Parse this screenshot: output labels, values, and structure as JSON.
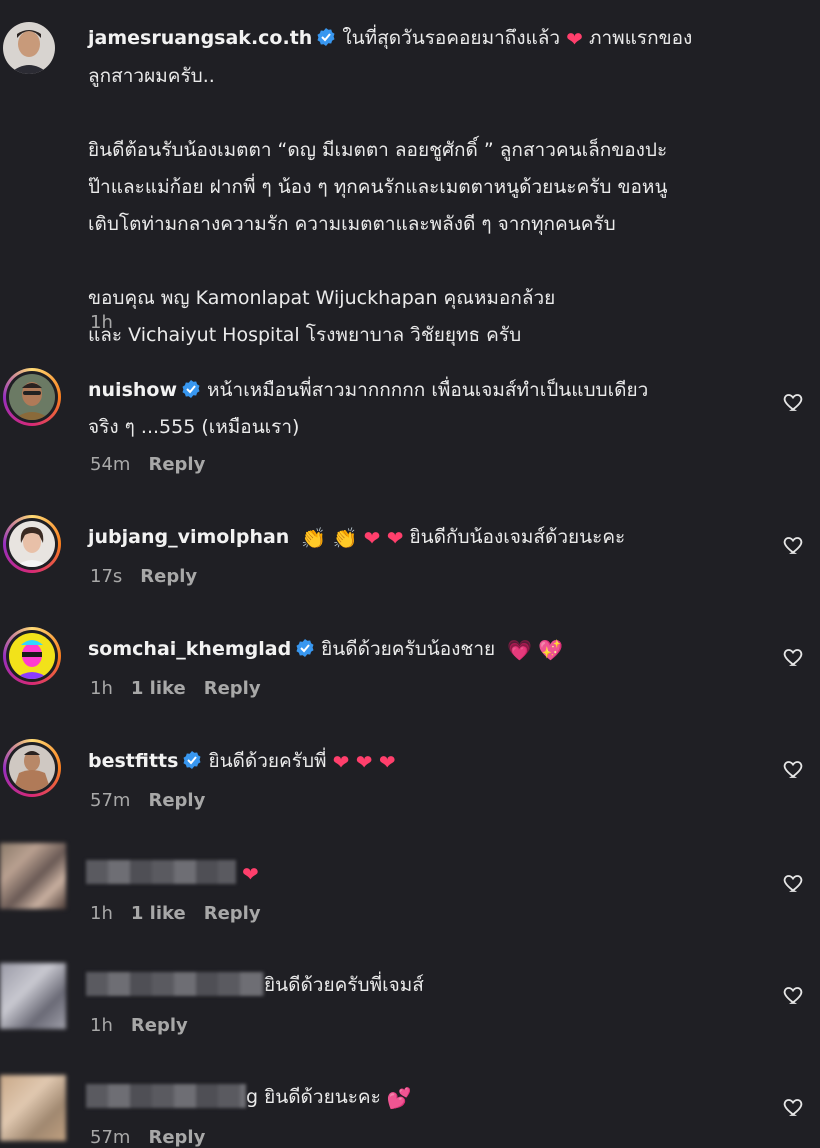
{
  "post": {
    "username": "jamesruangsak.co.th",
    "line1": "ในที่สุดวันรอคอยมาถึงแล้ว",
    "line1b": "ภาพแรกของ",
    "line2": "ลูกสาวผมครับ..",
    "para2_l1": "ยินดีต้อนรับน้องเมตตา “ดญ มีเมตตา ลอยชูศักดิ์ ” ลูกสาวคนเล็กของปะ",
    "para2_l2": "ป๊าและแม่ก้อย ฝากพี่ ๆ น้อง ๆ ทุกคนรักและเมตตาหนูด้วยนะครับ ขอหนู",
    "para2_l3": "เติบโตท่ามกลางความรัก ความเมตตาและพลังดี ๆ จากทุกคนครับ",
    "para3_l1": "ขอบคุณ พญ Kamonlapat Wijuckhapan คุณหมอกล้วย",
    "para3_l2": "และ Vichaiyut Hospital โรงพยาบาล วิชัยยุทธ ครับ",
    "time": "1h"
  },
  "comments": [
    {
      "username": "nuishow",
      "verified": true,
      "text_l1": "หน้าเหมือนพี่สาวมากกกกก เพื่อนเจมส์ทำเป็นแบบเดียว",
      "text_l2": "จริง ๆ ...555 (เหมือนเรา)",
      "time": "54m",
      "likes": "",
      "reply": "Reply"
    },
    {
      "username": "jubjang_vimolphan",
      "verified": false,
      "emojis": "👏 👏",
      "text": "ยินดีกับน้องเจมส์ด้วยนะคะ",
      "time": "17s",
      "likes": "",
      "reply": "Reply"
    },
    {
      "username": "somchai_khemglad",
      "verified": true,
      "text": "ยินดีด้วยครับน้องชาย",
      "emojis": "💗 💖",
      "time": "1h",
      "likes": "1 like",
      "reply": "Reply"
    },
    {
      "username": "bestfitts",
      "verified": true,
      "text": "ยินดีด้วยครับพี่",
      "time": "57m",
      "likes": "",
      "reply": "Reply"
    },
    {
      "username": "",
      "text": "",
      "time": "1h",
      "likes": "1 like",
      "reply": "Reply"
    },
    {
      "username": "",
      "text": "ยินดีด้วยครับพี่เจมส์",
      "time": "1h",
      "likes": "",
      "reply": "Reply"
    },
    {
      "username": "",
      "text": "g ยินดีด้วยนะคะ",
      "emojis": "💕",
      "time": "57m",
      "likes": "",
      "reply": "Reply"
    }
  ]
}
